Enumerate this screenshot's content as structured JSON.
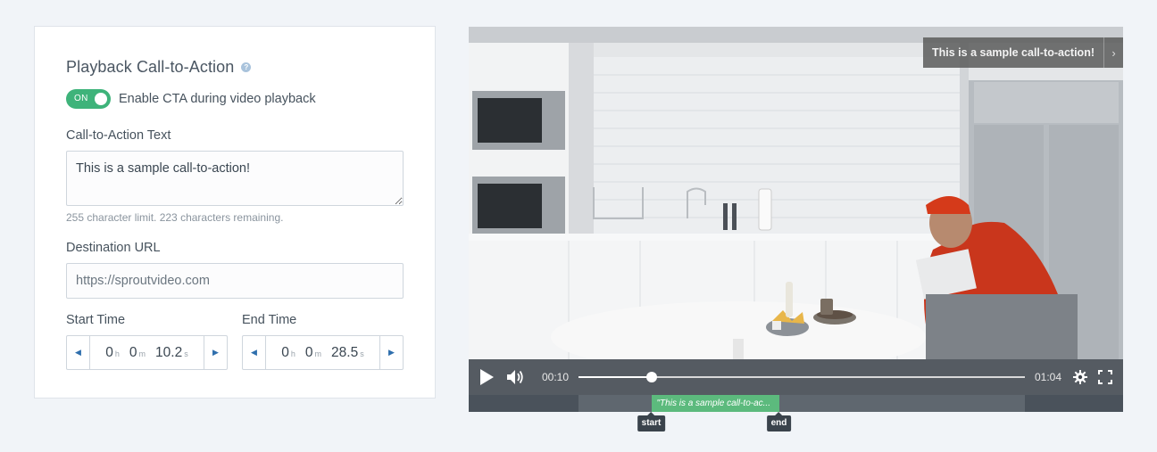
{
  "panel": {
    "title": "Playback Call-to-Action",
    "help_icon": "question-circle-icon",
    "toggle": {
      "state_label": "ON",
      "on": true,
      "color": "#3eb37a"
    },
    "toggle_text": "Enable CTA during video playback",
    "cta_text_label": "Call-to-Action Text",
    "cta_text_value": "This is a sample call-to-action!",
    "char_hint": "255 character limit. 223 characters remaining.",
    "url_label": "Destination URL",
    "url_placeholder": "https://sproutvideo.com",
    "start_time": {
      "label": "Start Time",
      "h": "0",
      "m": "0",
      "s": "10.2",
      "unit_h": "h",
      "unit_m": "m",
      "unit_s": "s"
    },
    "end_time": {
      "label": "End Time",
      "h": "0",
      "m": "0",
      "s": "28.5",
      "unit_h": "h",
      "unit_m": "m",
      "unit_s": "s"
    }
  },
  "player": {
    "cta_overlay_text": "This is a sample call-to-action!",
    "current_time": "00:10",
    "total_time": "01:04",
    "progress_fraction": 0.163,
    "cta_start_fraction": 0.163,
    "cta_end_fraction": 0.449,
    "cta_range_label": "\"This is a sample call-to-ac...",
    "start_marker": "start",
    "end_marker": "end",
    "icons": [
      "play-icon",
      "volume-icon",
      "gear-icon",
      "fullscreen-icon",
      "chevron-right-icon"
    ],
    "colors": {
      "cta_green": "#5cba7d",
      "controls_bg": "#30363d"
    }
  }
}
